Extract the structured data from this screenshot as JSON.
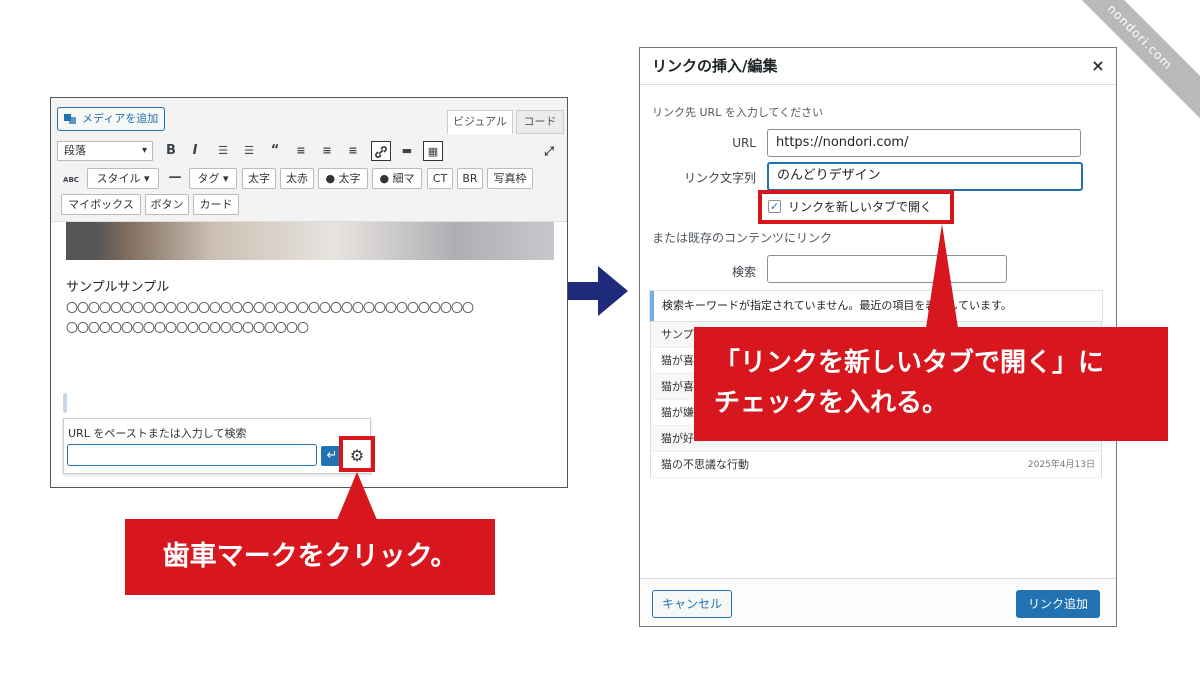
{
  "corner_ribbon": "nondori.com",
  "editor": {
    "media_button": "メディアを追加",
    "tab_visual": "ビジュアル",
    "tab_code": "コード",
    "format_select": "段落",
    "toolbar_row2": [
      "スタイル",
      "タグ",
      "太字",
      "太赤",
      "太字",
      "細マ",
      "CT",
      "BR",
      "写真枠"
    ],
    "toolbar_row3": [
      "マイボックス",
      "ボタン",
      "カード"
    ],
    "sample_text": "サンプルサンプル",
    "circles_line1": "〇〇〇〇〇〇〇〇〇〇〇〇〇〇〇〇〇〇〇〇〇〇〇〇〇〇〇〇〇〇〇〇〇〇〇〇〇",
    "circles_line2": "〇〇〇〇〇〇〇〇〇〇〇〇〇〇〇〇〇〇〇〇〇〇",
    "link_popup_label": "URL をペーストまたは入力して検索",
    "link_popup_value": ""
  },
  "callout_left": "歯車マークをクリック。",
  "callout_right_line1": "「リンクを新しいタブで開く」に",
  "callout_right_line2": "チェックを入れる。",
  "dialog": {
    "title": "リンクの挿入/編集",
    "close": "×",
    "intro": "リンク先 URL を入力してください",
    "url_label": "URL",
    "url_value": "https://nondori.com/",
    "text_label": "リンク文字列",
    "text_value": "のんどりデザイン",
    "newtab_label": "リンクを新しいタブで開く",
    "newtab_checked": true,
    "existing_label": "または既存のコンテンツにリンク",
    "search_label": "検索",
    "search_value": "",
    "notice": "検索キーワードが指定されていません。最近の項目を表示しています。",
    "results": [
      {
        "title": "サンプ",
        "date": ""
      },
      {
        "title": "猫が喜",
        "date": ""
      },
      {
        "title": "猫が喜",
        "date": ""
      },
      {
        "title": "猫が嫌",
        "date": ""
      },
      {
        "title": "猫が好",
        "date": ""
      },
      {
        "title": "猫の不思議な行動",
        "date": "2025年4月13日"
      }
    ],
    "cancel": "キャンセル",
    "add": "リンク追加"
  },
  "colors": {
    "callout_red": "#d7161d",
    "wp_blue": "#2271b1",
    "arrow_navy": "#1f2a7a"
  }
}
